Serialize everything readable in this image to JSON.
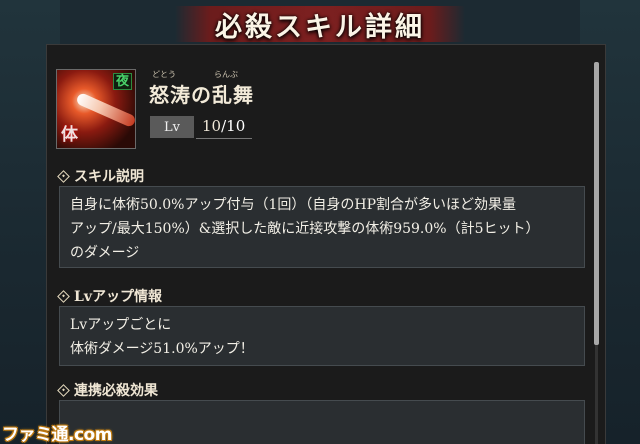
{
  "window_title": "必殺スキル詳細",
  "skill": {
    "name": "怒涛の乱舞",
    "ruby": [
      "どとう",
      "らんぶ"
    ],
    "icon_tags": {
      "night": "夜",
      "body": "体"
    },
    "level_label": "Lv",
    "level_current": "10",
    "level_max": "/10"
  },
  "sections": {
    "skill_desc": {
      "header": "スキル説明",
      "lines": [
        "自身に体術50.0%アップ付与（1回）（自身のHP割合が多いほど効果量",
        "アップ/最大150%）&選択した敵に近接攻撃の体術959.0%（計5ヒット）",
        "のダメージ"
      ]
    },
    "lv_up": {
      "header": "Lvアップ情報",
      "lines": [
        "Lvアップごとに",
        "体術ダメージ51.0%アップ！"
      ]
    },
    "combo": {
      "header": "連携必殺効果"
    }
  },
  "watermark": "ファミ通.com",
  "colors": {
    "banner": "#7d2020",
    "panel": "#1b1b1b",
    "night_tag": "#4ad26a"
  }
}
